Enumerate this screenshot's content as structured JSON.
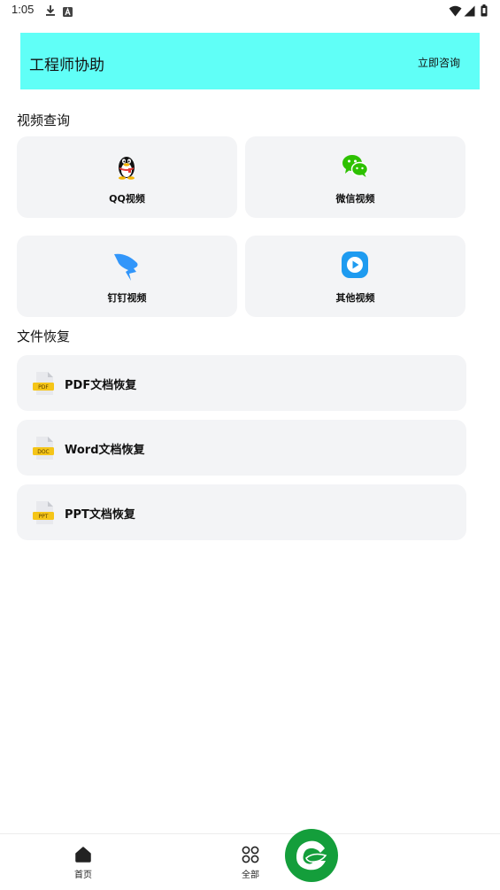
{
  "status_bar": {
    "time": "1:05"
  },
  "banner": {
    "title": "工程师协助",
    "consult_label": "立即咨询",
    "background": "#60fff7"
  },
  "video_section": {
    "title": "视频查询",
    "cards": [
      {
        "label": "QQ视频",
        "icon": "qq-penguin-icon"
      },
      {
        "label": "微信视频",
        "icon": "wechat-icon"
      },
      {
        "label": "钉钉视频",
        "icon": "dingtalk-icon"
      },
      {
        "label": "其他视频",
        "icon": "play-icon"
      }
    ]
  },
  "file_section": {
    "title": "文件恢复",
    "items": [
      {
        "label": "PDF文档恢复",
        "icon": "pdf-file-icon",
        "badge": "PDF"
      },
      {
        "label": "Word文档恢复",
        "icon": "doc-file-icon",
        "badge": "DOC"
      },
      {
        "label": "PPT文档恢复",
        "icon": "ppt-file-icon",
        "badge": "PPT"
      }
    ]
  },
  "bottom_nav": {
    "items": [
      {
        "label": "首页",
        "icon": "home-icon"
      },
      {
        "label": "全部",
        "icon": "grid-icon"
      }
    ],
    "fab_icon": "leaf-logo-icon",
    "fab_color": "#149e3b"
  },
  "colors": {
    "card_bg": "#f3f4f6",
    "wechat_green": "#2dc100",
    "dingtalk_blue": "#3296fa",
    "play_blue": "#1e9bf0",
    "file_badge": "#f5c518"
  }
}
